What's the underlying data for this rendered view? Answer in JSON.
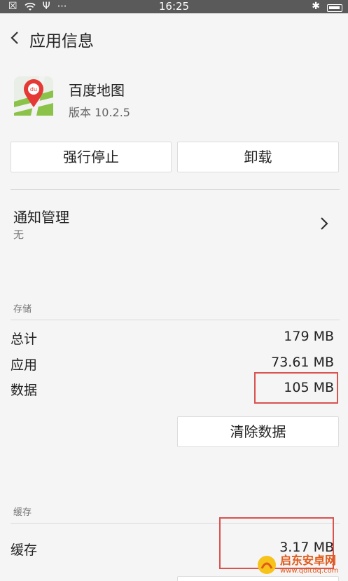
{
  "status_bar": {
    "time": "16:25",
    "left_icons": [
      "notification-x-icon",
      "wifi-icon",
      "usb-icon",
      "more-icon"
    ],
    "right_icons": [
      "bluetooth-icon",
      "battery-icon"
    ],
    "color": "#5a5a5a"
  },
  "header": {
    "title": "应用信息"
  },
  "app": {
    "name": "百度地图",
    "version": "版本 10.2.5",
    "icon_label": "du"
  },
  "actions": {
    "force_stop": "强行停止",
    "uninstall": "卸载"
  },
  "notification": {
    "title": "通知管理",
    "value": "无"
  },
  "storage": {
    "section_label": "存储",
    "rows": [
      {
        "label": "总计",
        "value": "179 MB"
      },
      {
        "label": "应用",
        "value": "73.61 MB"
      },
      {
        "label": "数据",
        "value": "105 MB"
      }
    ],
    "clear_data": "清除数据"
  },
  "cache": {
    "section_label": "缓存",
    "label": "缓存",
    "value": "3.17 MB",
    "clear_cache": ""
  },
  "watermark": {
    "line1": "启东安卓网",
    "line2": "www.qdltdq.com"
  },
  "colors": {
    "background": "#f5f5f5",
    "highlight": "#d9534f",
    "watermark": "#e05a1a"
  }
}
